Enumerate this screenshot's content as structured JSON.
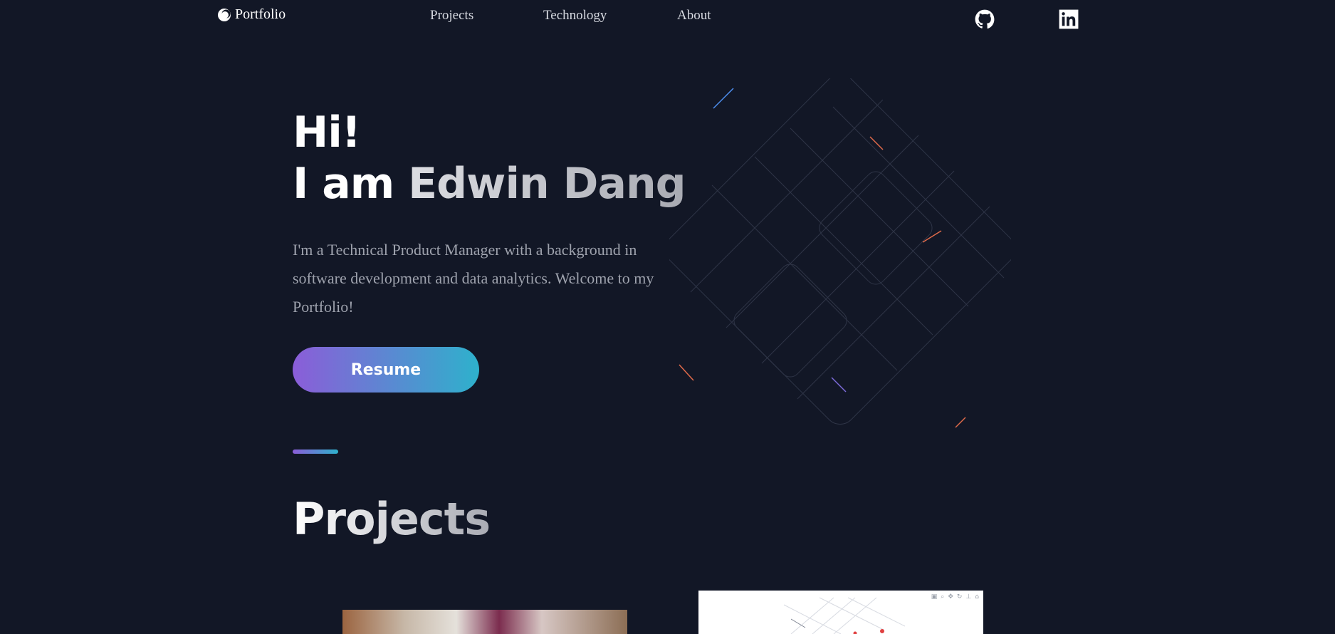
{
  "nav": {
    "brand": "Portfolio",
    "links": [
      "Projects",
      "Technology",
      "About"
    ],
    "social": [
      "github-icon",
      "linkedin-icon"
    ]
  },
  "hero": {
    "greeting": "Hi!",
    "name_prefix": "I am",
    "name": "Edwin Dang",
    "intro": "I'm a Technical Product Manager with a background in software development and data analytics. Welcome to my Portfolio!",
    "resume_label": "Resume"
  },
  "sections": {
    "projects_title": "Projects"
  },
  "colors": {
    "background": "#121726",
    "accent_start": "#8b5dd8",
    "accent_end": "#2eb1cc"
  }
}
